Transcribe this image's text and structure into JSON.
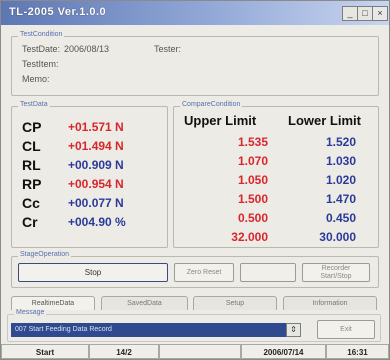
{
  "window": {
    "title": "TL-2005 Ver.1.0.0"
  },
  "test_condition": {
    "group_label": "TestCondition",
    "date_label": "TestDate:",
    "date_value": "2006/08/13",
    "tester_label": "Tester:",
    "item_label": "TestItem:",
    "memo_label": "Memo:"
  },
  "test_data": {
    "group_label": "TestData",
    "rows": [
      {
        "name": "CP",
        "value": "+01.571 N",
        "color": "#d9262c"
      },
      {
        "name": "CL",
        "value": "+01.494 N",
        "color": "#d9262c"
      },
      {
        "name": "RL",
        "value": "+00.909 N",
        "color": "#2b3a9a"
      },
      {
        "name": "RP",
        "value": "+00.954 N",
        "color": "#d9262c"
      },
      {
        "name": "Cc",
        "value": "+00.077 N",
        "color": "#2b3a9a"
      },
      {
        "name": "Cr",
        "value": "+004.90 %",
        "color": "#2b3a9a"
      }
    ]
  },
  "compare_condition": {
    "group_label": "CompareCondition",
    "upper_header": "Upper Limit",
    "lower_header": "Lower Limit",
    "upper": [
      "1.535",
      "1.070",
      "1.050",
      "1.500",
      "0.500",
      "32.000"
    ],
    "lower": [
      "1.520",
      "1.030",
      "1.020",
      "1.470",
      "0.450",
      "30.000"
    ]
  },
  "stage_operation": {
    "group_label": "StageOperation",
    "stop_label": "Stop",
    "zero_reset_label": "Zero Reset",
    "blank_label": "",
    "record_label": "Recorder\nStart/Stop"
  },
  "tabs": [
    {
      "label": "RealtimeData",
      "active": true
    },
    {
      "label": "SavedData",
      "active": false
    },
    {
      "label": "Setup",
      "active": false
    },
    {
      "label": "Information",
      "active": false
    }
  ],
  "message": {
    "group_label": "Message",
    "text": "007 Start Feeding Data Record",
    "exit_label": "Exit"
  },
  "statusbar": {
    "state": "Start",
    "count": "14/2",
    "blank": "",
    "date": "2006/07/14",
    "time": "16:31"
  },
  "colors": {
    "fail_red": "#d9262c",
    "pass_blue": "#2b3a9a",
    "title_blue": "#5d77b4"
  }
}
